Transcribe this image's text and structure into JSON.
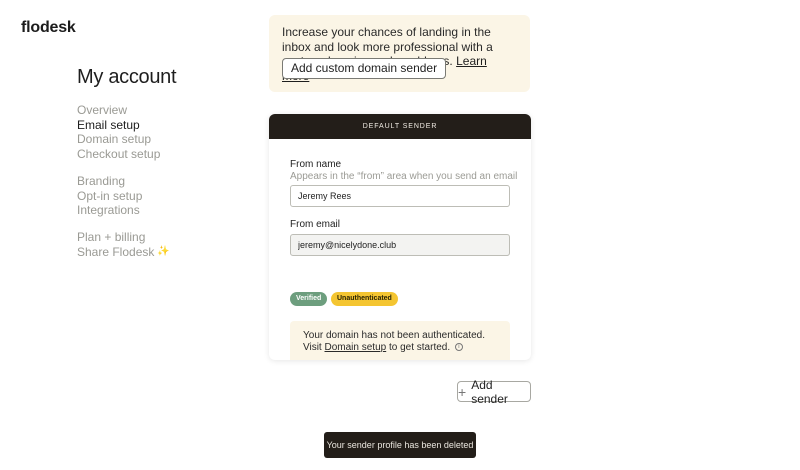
{
  "app": {
    "logo": "flodesk"
  },
  "page": {
    "title": "My account"
  },
  "sidebar": {
    "groups": [
      {
        "items": [
          {
            "label": "Overview"
          },
          {
            "label": "Email setup"
          },
          {
            "label": "Domain setup"
          },
          {
            "label": "Checkout setup"
          }
        ]
      },
      {
        "items": [
          {
            "label": "Branding"
          },
          {
            "label": "Opt-in setup"
          },
          {
            "label": "Integrations"
          }
        ]
      },
      {
        "items": [
          {
            "label": "Plan + billing"
          },
          {
            "label": "Share Flodesk"
          }
        ]
      }
    ],
    "active_item": "Email setup"
  },
  "banner": {
    "text": "Increase your chances of landing in the inbox and look more professional with a custom domain sender address.",
    "link_label": "Learn more",
    "button_label": "Add custom domain sender"
  },
  "sender_card": {
    "header": "DEFAULT SENDER",
    "from_name": {
      "label": "From name",
      "hint": "Appears in the “from” area when you send an email",
      "value": "Jeremy Rees"
    },
    "from_email": {
      "label": "From email",
      "value": "jeremy@nicelydone.club"
    },
    "badges": {
      "verified": "Verified",
      "unauthenticated": "Unauthenticated"
    },
    "notice": {
      "text_before": "Your domain has not been authenticated. Visit ",
      "link_label": "Domain setup",
      "text_after": " to get started."
    }
  },
  "actions": {
    "add_sender_label": "Add sender"
  },
  "toast": {
    "message": "Your sender profile has been deleted"
  },
  "colors": {
    "accent_dark": "#231e19",
    "banner_bg": "#fbf5e6",
    "verified": "#6d9e7e",
    "unauthenticated": "#f4c531"
  }
}
